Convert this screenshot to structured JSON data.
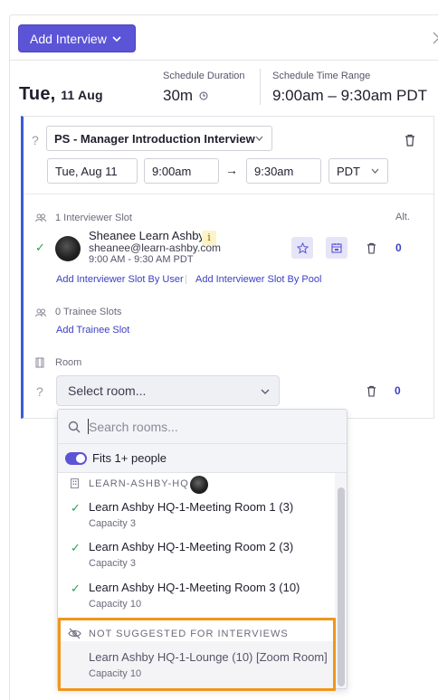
{
  "toolbar": {
    "add_interview_label": "Add Interview"
  },
  "schedule": {
    "date_weekday": "Tue,",
    "date_day": "11 Aug",
    "duration_label": "Schedule Duration",
    "duration_value": "30m",
    "time_range_label": "Schedule Time Range",
    "time_range_value": "9:00am – 9:30am PDT"
  },
  "interview": {
    "type_value": "PS - Manager Introduction Interview",
    "date_value": "Tue, Aug 11",
    "start_time": "9:00am",
    "arrow": "→",
    "end_time": "9:30am",
    "timezone": "PDT"
  },
  "interviewers": {
    "slot_label": "1 Interviewer Slot",
    "alt_label": "Alt.",
    "alt_count": "0",
    "person": {
      "name": "Sheanee Learn Ashby",
      "email": "sheanee@learn-ashby.com",
      "time": "9:00 AM - 9:30 AM PDT",
      "info_badge": "i"
    },
    "add_by_user": "Add Interviewer Slot By User",
    "add_by_pool": "Add Interviewer Slot By Pool"
  },
  "trainees": {
    "slot_label": "0 Trainee Slots",
    "add_label": "Add Trainee Slot"
  },
  "room": {
    "label": "Room",
    "select_placeholder": "Select room...",
    "alt_count": "0"
  },
  "room_dropdown": {
    "search_placeholder": "Search rooms...",
    "fits_label": "Fits 1+ people",
    "fits_enabled": true,
    "group_name": "LEARN-ASHBY-HQ",
    "rooms": [
      {
        "name": "Learn Ashby HQ-1-Meeting Room 1 (3)",
        "capacity": "Capacity 3"
      },
      {
        "name": "Learn Ashby HQ-1-Meeting Room 2 (3)",
        "capacity": "Capacity 3"
      },
      {
        "name": "Learn Ashby HQ-1-Meeting Room 3 (10)",
        "capacity": "Capacity 10"
      }
    ],
    "not_suggested_label": "NOT SUGGESTED FOR INTERVIEWS",
    "not_suggested_rooms": [
      {
        "name": "Learn Ashby HQ-1-Lounge (10) [Zoom Room]",
        "capacity": "Capacity 10"
      }
    ]
  },
  "colors": {
    "accent": "#5b54d6",
    "link": "#3b3fc4",
    "check": "#2ca05a",
    "card_border": "#3a5bd9",
    "highlight": "#f0961b"
  }
}
